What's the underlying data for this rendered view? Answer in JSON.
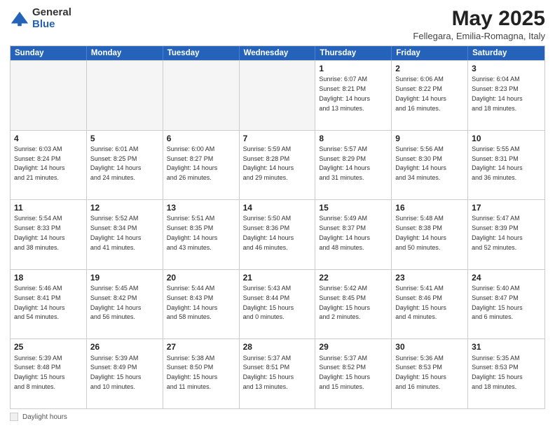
{
  "logo": {
    "general": "General",
    "blue": "Blue"
  },
  "title": "May 2025",
  "location": "Fellegara, Emilia-Romagna, Italy",
  "days_of_week": [
    "Sunday",
    "Monday",
    "Tuesday",
    "Wednesday",
    "Thursday",
    "Friday",
    "Saturday"
  ],
  "weeks": [
    [
      {
        "day": "",
        "info": "",
        "empty": true
      },
      {
        "day": "",
        "info": "",
        "empty": true
      },
      {
        "day": "",
        "info": "",
        "empty": true
      },
      {
        "day": "",
        "info": "",
        "empty": true
      },
      {
        "day": "1",
        "info": "Sunrise: 6:07 AM\nSunset: 8:21 PM\nDaylight: 14 hours\nand 13 minutes.",
        "empty": false
      },
      {
        "day": "2",
        "info": "Sunrise: 6:06 AM\nSunset: 8:22 PM\nDaylight: 14 hours\nand 16 minutes.",
        "empty": false
      },
      {
        "day": "3",
        "info": "Sunrise: 6:04 AM\nSunset: 8:23 PM\nDaylight: 14 hours\nand 18 minutes.",
        "empty": false
      }
    ],
    [
      {
        "day": "4",
        "info": "Sunrise: 6:03 AM\nSunset: 8:24 PM\nDaylight: 14 hours\nand 21 minutes.",
        "empty": false
      },
      {
        "day": "5",
        "info": "Sunrise: 6:01 AM\nSunset: 8:25 PM\nDaylight: 14 hours\nand 24 minutes.",
        "empty": false
      },
      {
        "day": "6",
        "info": "Sunrise: 6:00 AM\nSunset: 8:27 PM\nDaylight: 14 hours\nand 26 minutes.",
        "empty": false
      },
      {
        "day": "7",
        "info": "Sunrise: 5:59 AM\nSunset: 8:28 PM\nDaylight: 14 hours\nand 29 minutes.",
        "empty": false
      },
      {
        "day": "8",
        "info": "Sunrise: 5:57 AM\nSunset: 8:29 PM\nDaylight: 14 hours\nand 31 minutes.",
        "empty": false
      },
      {
        "day": "9",
        "info": "Sunrise: 5:56 AM\nSunset: 8:30 PM\nDaylight: 14 hours\nand 34 minutes.",
        "empty": false
      },
      {
        "day": "10",
        "info": "Sunrise: 5:55 AM\nSunset: 8:31 PM\nDaylight: 14 hours\nand 36 minutes.",
        "empty": false
      }
    ],
    [
      {
        "day": "11",
        "info": "Sunrise: 5:54 AM\nSunset: 8:33 PM\nDaylight: 14 hours\nand 38 minutes.",
        "empty": false
      },
      {
        "day": "12",
        "info": "Sunrise: 5:52 AM\nSunset: 8:34 PM\nDaylight: 14 hours\nand 41 minutes.",
        "empty": false
      },
      {
        "day": "13",
        "info": "Sunrise: 5:51 AM\nSunset: 8:35 PM\nDaylight: 14 hours\nand 43 minutes.",
        "empty": false
      },
      {
        "day": "14",
        "info": "Sunrise: 5:50 AM\nSunset: 8:36 PM\nDaylight: 14 hours\nand 46 minutes.",
        "empty": false
      },
      {
        "day": "15",
        "info": "Sunrise: 5:49 AM\nSunset: 8:37 PM\nDaylight: 14 hours\nand 48 minutes.",
        "empty": false
      },
      {
        "day": "16",
        "info": "Sunrise: 5:48 AM\nSunset: 8:38 PM\nDaylight: 14 hours\nand 50 minutes.",
        "empty": false
      },
      {
        "day": "17",
        "info": "Sunrise: 5:47 AM\nSunset: 8:39 PM\nDaylight: 14 hours\nand 52 minutes.",
        "empty": false
      }
    ],
    [
      {
        "day": "18",
        "info": "Sunrise: 5:46 AM\nSunset: 8:41 PM\nDaylight: 14 hours\nand 54 minutes.",
        "empty": false
      },
      {
        "day": "19",
        "info": "Sunrise: 5:45 AM\nSunset: 8:42 PM\nDaylight: 14 hours\nand 56 minutes.",
        "empty": false
      },
      {
        "day": "20",
        "info": "Sunrise: 5:44 AM\nSunset: 8:43 PM\nDaylight: 14 hours\nand 58 minutes.",
        "empty": false
      },
      {
        "day": "21",
        "info": "Sunrise: 5:43 AM\nSunset: 8:44 PM\nDaylight: 15 hours\nand 0 minutes.",
        "empty": false
      },
      {
        "day": "22",
        "info": "Sunrise: 5:42 AM\nSunset: 8:45 PM\nDaylight: 15 hours\nand 2 minutes.",
        "empty": false
      },
      {
        "day": "23",
        "info": "Sunrise: 5:41 AM\nSunset: 8:46 PM\nDaylight: 15 hours\nand 4 minutes.",
        "empty": false
      },
      {
        "day": "24",
        "info": "Sunrise: 5:40 AM\nSunset: 8:47 PM\nDaylight: 15 hours\nand 6 minutes.",
        "empty": false
      }
    ],
    [
      {
        "day": "25",
        "info": "Sunrise: 5:39 AM\nSunset: 8:48 PM\nDaylight: 15 hours\nand 8 minutes.",
        "empty": false
      },
      {
        "day": "26",
        "info": "Sunrise: 5:39 AM\nSunset: 8:49 PM\nDaylight: 15 hours\nand 10 minutes.",
        "empty": false
      },
      {
        "day": "27",
        "info": "Sunrise: 5:38 AM\nSunset: 8:50 PM\nDaylight: 15 hours\nand 11 minutes.",
        "empty": false
      },
      {
        "day": "28",
        "info": "Sunrise: 5:37 AM\nSunset: 8:51 PM\nDaylight: 15 hours\nand 13 minutes.",
        "empty": false
      },
      {
        "day": "29",
        "info": "Sunrise: 5:37 AM\nSunset: 8:52 PM\nDaylight: 15 hours\nand 15 minutes.",
        "empty": false
      },
      {
        "day": "30",
        "info": "Sunrise: 5:36 AM\nSunset: 8:53 PM\nDaylight: 15 hours\nand 16 minutes.",
        "empty": false
      },
      {
        "day": "31",
        "info": "Sunrise: 5:35 AM\nSunset: 8:53 PM\nDaylight: 15 hours\nand 18 minutes.",
        "empty": false
      }
    ]
  ],
  "footer": {
    "box_label": "Daylight hours"
  }
}
